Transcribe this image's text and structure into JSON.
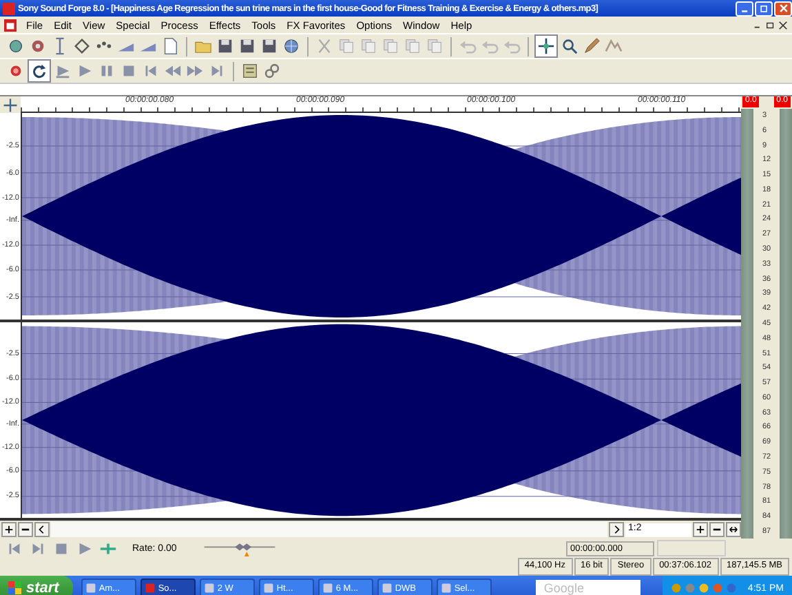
{
  "window": {
    "title": "Sony Sound Forge 8.0 - [Happiness Age Regression the sun trine mars in the first house-Good for Fitness Training & Exercise & Energy & others.mp3]"
  },
  "menu": [
    "File",
    "Edit",
    "View",
    "Special",
    "Process",
    "Effects",
    "Tools",
    "FX Favorites",
    "Options",
    "Window",
    "Help"
  ],
  "ruler": {
    "labels": [
      "00:00:00.080",
      "00:00:00.090",
      "00:00:00.100",
      "00:00:00.110"
    ]
  },
  "channels": [
    {
      "scale": [
        "-2.5",
        "-6.0",
        "-12.0",
        "-Inf.",
        "-12.0",
        "-6.0",
        "-2.5"
      ]
    },
    {
      "scale": [
        "-2.5",
        "-6.0",
        "-12.0",
        "-Inf.",
        "-12.0",
        "-6.0",
        "-2.5"
      ]
    }
  ],
  "meters": {
    "peaks": [
      "0.0",
      "0.0"
    ],
    "scale": [
      "3",
      "6",
      "9",
      "12",
      "15",
      "18",
      "21",
      "24",
      "27",
      "30",
      "33",
      "36",
      "39",
      "42",
      "45",
      "48",
      "51",
      "54",
      "57",
      "60",
      "63",
      "66",
      "69",
      "72",
      "75",
      "78",
      "81",
      "84",
      "87"
    ]
  },
  "scroll": {
    "zoom": "1:2"
  },
  "transport": {
    "rate": "Rate: 0.00",
    "level": 0.55,
    "position": "00:00:00.000"
  },
  "status": [
    "44,100 Hz",
    "16 bit",
    "Stereo",
    "00:37:06.102",
    "187,145.5 MB"
  ],
  "taskbar": {
    "start": "start",
    "tasks": [
      {
        "label": "Am...",
        "selected": false
      },
      {
        "label": "So...",
        "selected": true
      },
      {
        "label": "2 W",
        "selected": false
      },
      {
        "label": "Ht...",
        "selected": false
      },
      {
        "label": "6 M...",
        "selected": false
      },
      {
        "label": "DWB",
        "selected": false
      },
      {
        "label": "Sel...",
        "selected": false
      }
    ],
    "search": "Google",
    "clock": "4:51 PM"
  }
}
